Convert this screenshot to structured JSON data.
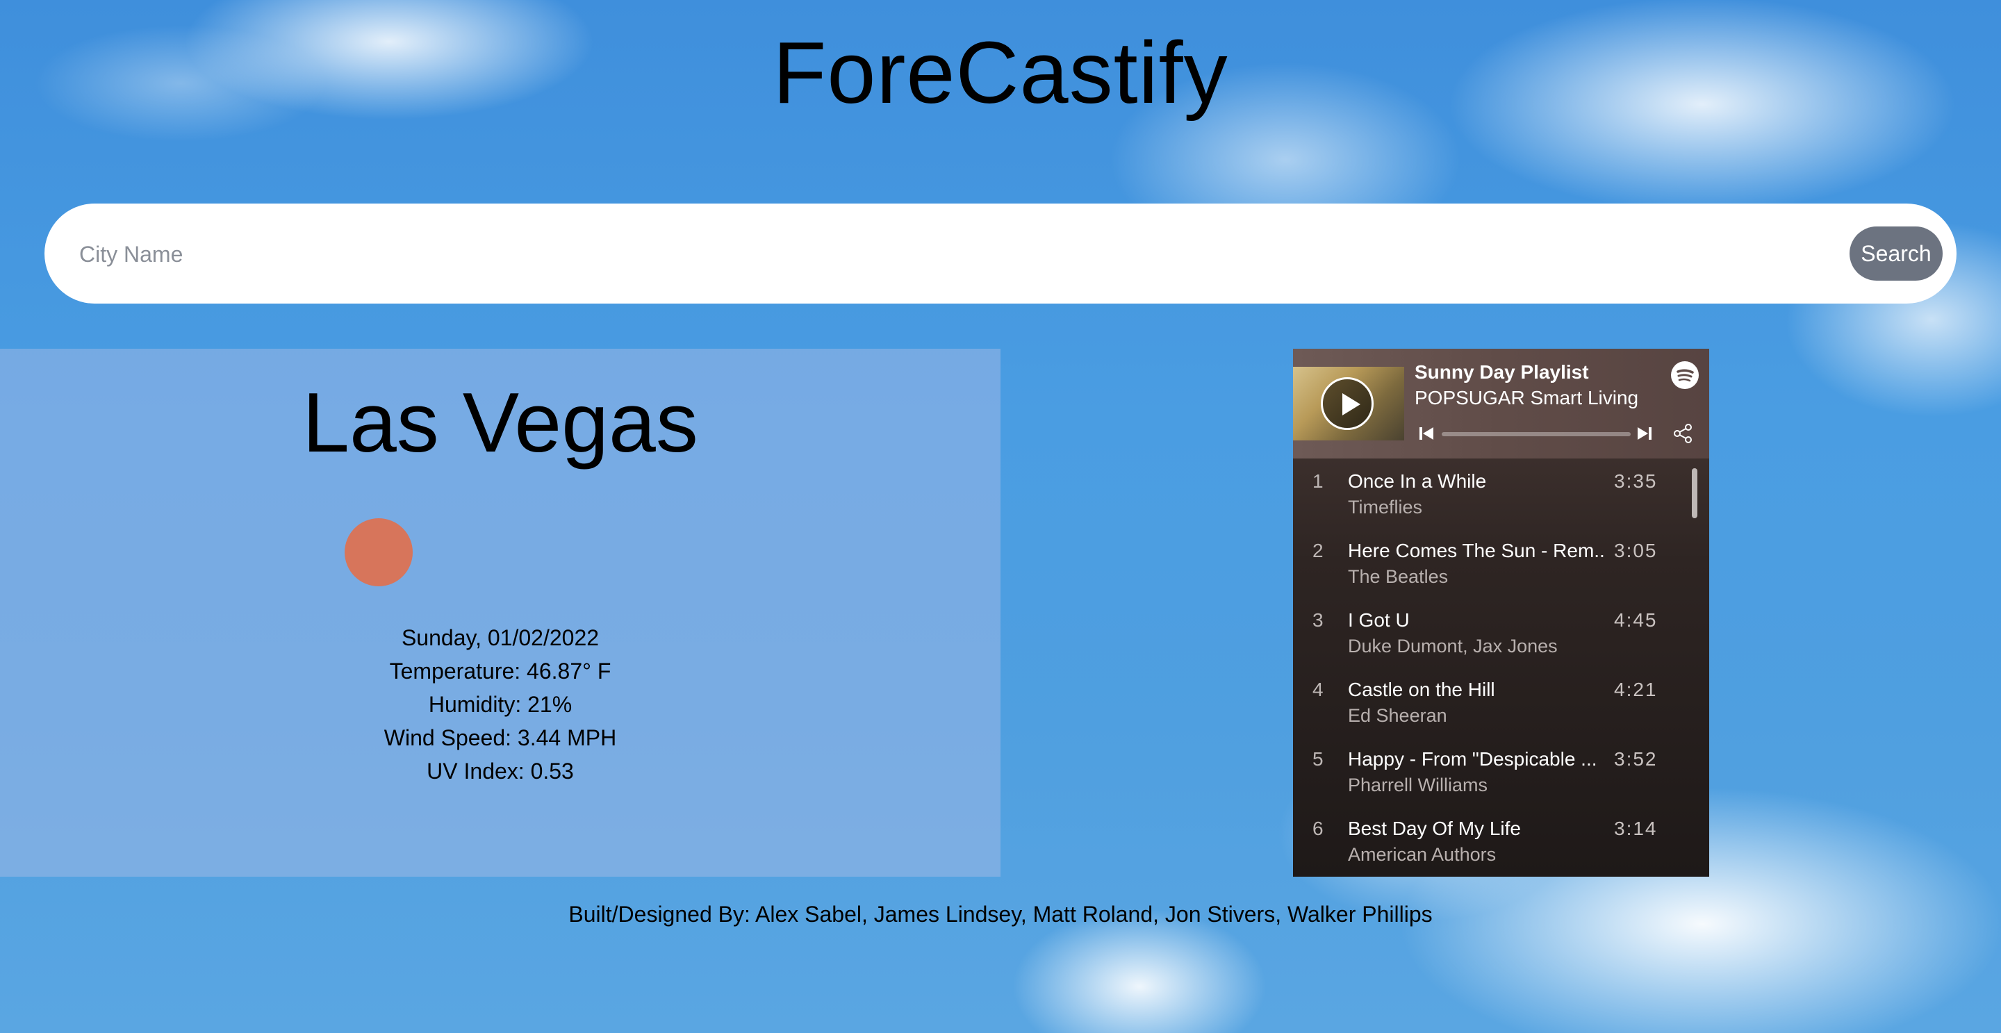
{
  "app": {
    "title": "ForeCastify"
  },
  "search": {
    "placeholder": "City Name",
    "value": "",
    "button_label": "Search"
  },
  "weather": {
    "city": "Las Vegas",
    "icon": "sun-icon",
    "icon_color": "#e0704f",
    "date": "Sunday, 01/02/2022",
    "temperature": "Temperature: 46.87° F",
    "humidity": "Humidity: 21%",
    "wind": "Wind Speed: 3.44 MPH",
    "uv": "UV Index: 0.53"
  },
  "player": {
    "playlist_title": "Sunny Day Playlist",
    "owner": "POPSUGAR Smart Living",
    "tracks": [
      {
        "num": "1",
        "title": "Once In a While",
        "artist": "Timeflies",
        "duration": "3:35"
      },
      {
        "num": "2",
        "title": "Here Comes The Sun - Rem...",
        "artist": "The Beatles",
        "duration": "3:05"
      },
      {
        "num": "3",
        "title": "I Got U",
        "artist": "Duke Dumont, Jax Jones",
        "duration": "4:45"
      },
      {
        "num": "4",
        "title": "Castle on the Hill",
        "artist": "Ed Sheeran",
        "duration": "4:21"
      },
      {
        "num": "5",
        "title": "Happy - From \"Despicable ...",
        "artist": "Pharrell Williams",
        "duration": "3:52"
      },
      {
        "num": "6",
        "title": "Best Day Of My Life",
        "artist": "American Authors",
        "duration": "3:14"
      }
    ]
  },
  "footer": {
    "credits": "Built/Designed By: Alex Sabel, James Lindsey, Matt Roland, Jon Stivers, Walker Phillips"
  }
}
